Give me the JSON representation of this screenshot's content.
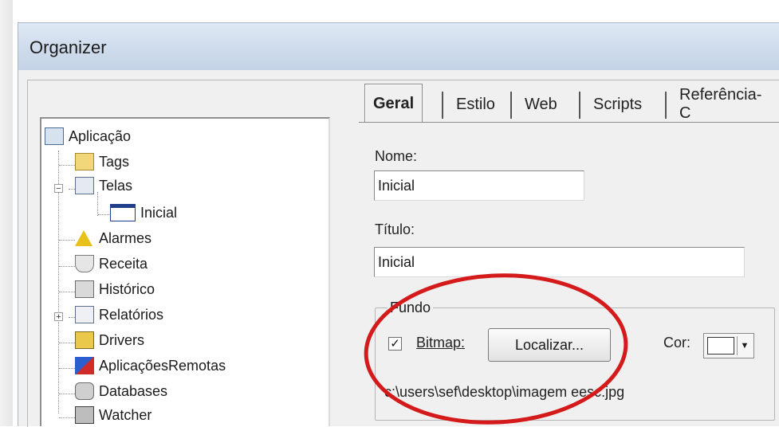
{
  "window": {
    "title": "Organizer"
  },
  "tree": {
    "items": [
      {
        "label": "Aplicação",
        "icon": "application-icon"
      },
      {
        "label": "Tags",
        "icon": "folder-tags-icon"
      },
      {
        "label": "Telas",
        "icon": "screens-icon",
        "expander": "−"
      },
      {
        "label": "Inicial",
        "icon": "window-icon"
      },
      {
        "label": "Alarmes",
        "icon": "alarm-icon"
      },
      {
        "label": "Receita",
        "icon": "recipe-icon"
      },
      {
        "label": "Histórico",
        "icon": "history-icon"
      },
      {
        "label": "Relatórios",
        "icon": "reports-icon",
        "expander": "+"
      },
      {
        "label": "Drivers",
        "icon": "drivers-icon"
      },
      {
        "label": "AplicaçõesRemotas",
        "icon": "remote-apps-icon"
      },
      {
        "label": "Databases",
        "icon": "database-icon"
      },
      {
        "label": "Watcher",
        "icon": "watcher-icon"
      }
    ]
  },
  "tabs": [
    {
      "label": "Geral",
      "active": true
    },
    {
      "label": "Estilo"
    },
    {
      "label": "Web"
    },
    {
      "label": "Scripts"
    },
    {
      "label": "Referência-C"
    }
  ],
  "form": {
    "nome_label": "Nome:",
    "nome_value": "Inicial",
    "titulo_label": "Título:",
    "titulo_value": "Inicial",
    "fundo_legend": "Fundo",
    "bitmap_label": "Bitmap:",
    "bitmap_checked": "✓",
    "localizar_label": "Localizar...",
    "cor_label": "Cor:",
    "cor_value": "#ffffff",
    "path_value": "c:\\users\\sef\\desktop\\imagem eesc.jpg"
  },
  "annotation": {
    "color": "#d41a1a"
  }
}
